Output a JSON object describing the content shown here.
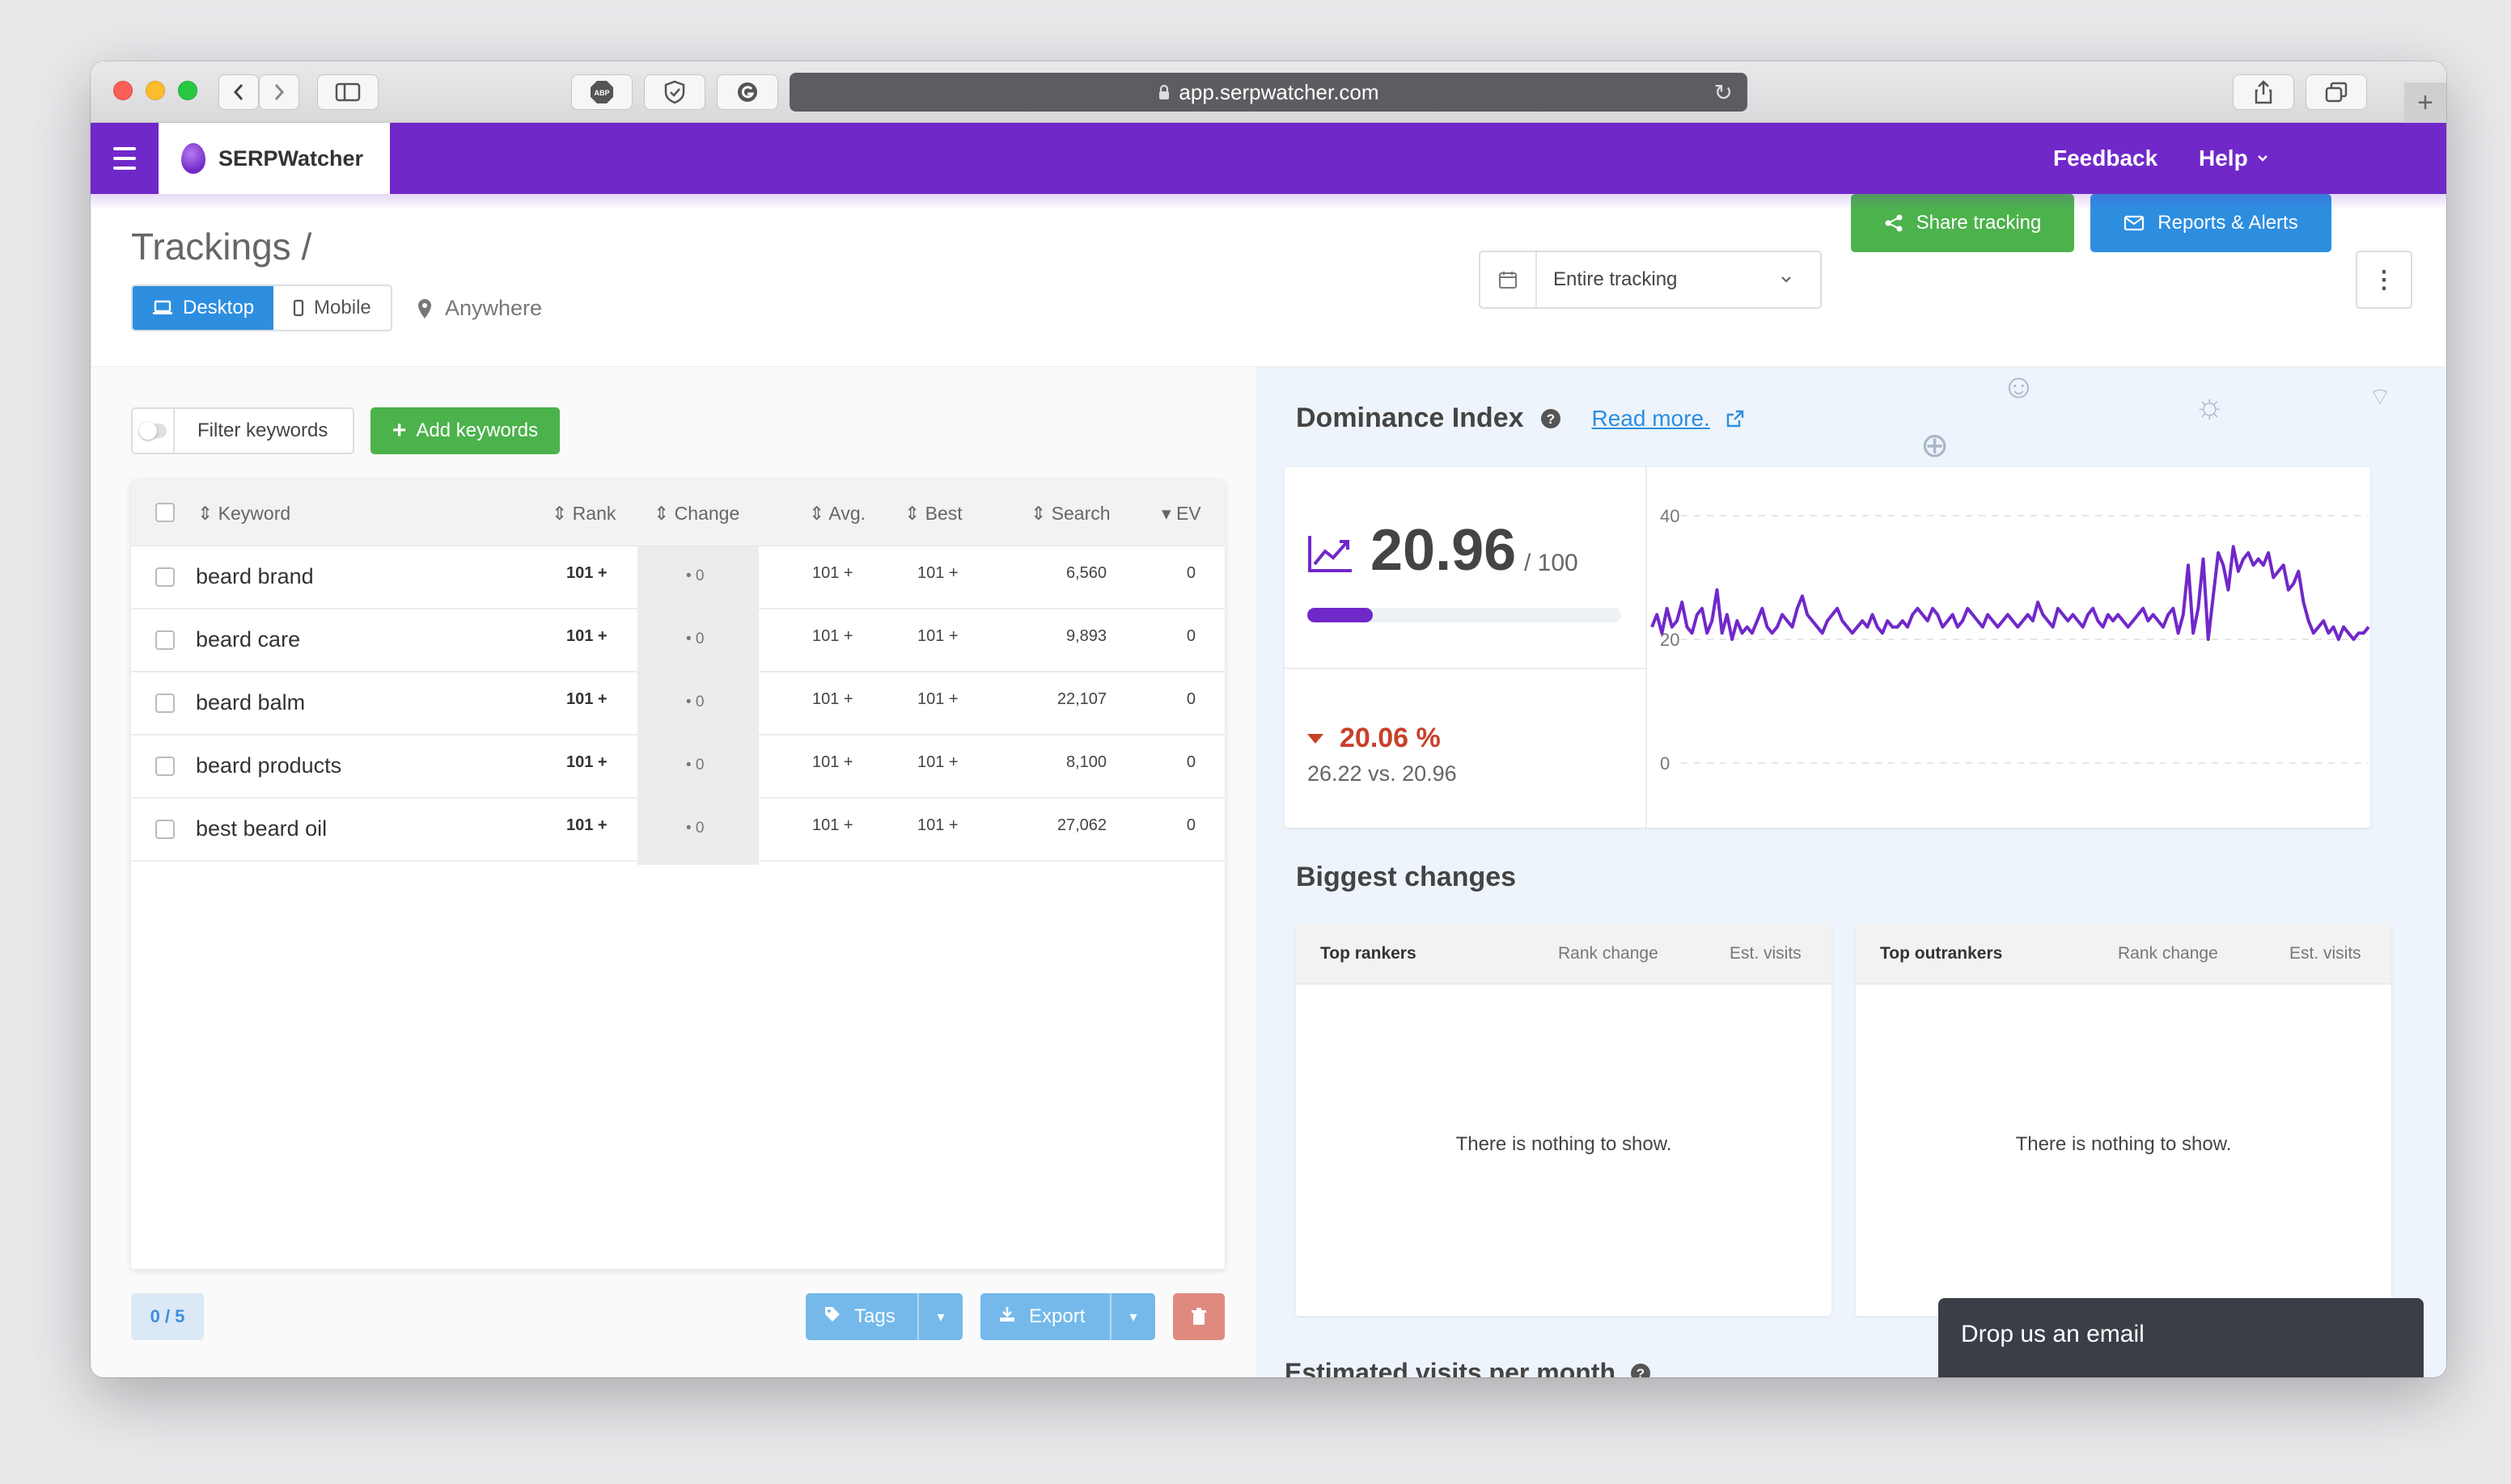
{
  "browser": {
    "url": "app.serpwatcher.com",
    "extensions": [
      "ABP",
      "shield-check",
      "G"
    ]
  },
  "app": {
    "brand": "SERPWatcher",
    "nav": {
      "feedback": "Feedback",
      "help": "Help"
    }
  },
  "page": {
    "title": "Trackings /",
    "device_tabs": [
      "Desktop",
      "Mobile"
    ],
    "location": "Anywhere",
    "date_range": "Entire tracking",
    "share_label": "Share tracking",
    "reports_label": "Reports & Alerts"
  },
  "keywords": {
    "filter_label": "Filter keywords",
    "add_label": "Add keywords",
    "columns": [
      "Keyword",
      "Rank",
      "Change",
      "Avg.",
      "Best",
      "Search",
      "EV"
    ],
    "rows": [
      {
        "keyword": "beard brand",
        "rank": "101 +",
        "change": "• 0",
        "avg": "101 +",
        "best": "101 +",
        "search": "6,560",
        "ev": "0"
      },
      {
        "keyword": "beard care",
        "rank": "101 +",
        "change": "• 0",
        "avg": "101 +",
        "best": "101 +",
        "search": "9,893",
        "ev": "0"
      },
      {
        "keyword": "beard balm",
        "rank": "101 +",
        "change": "• 0",
        "avg": "101 +",
        "best": "101 +",
        "search": "22,107",
        "ev": "0"
      },
      {
        "keyword": "beard products",
        "rank": "101 +",
        "change": "• 0",
        "avg": "101 +",
        "best": "101 +",
        "search": "8,100",
        "ev": "0"
      },
      {
        "keyword": "best beard oil",
        "rank": "101 +",
        "change": "• 0",
        "avg": "101 +",
        "best": "101 +",
        "search": "27,062",
        "ev": "0"
      }
    ],
    "selection_count": "0 / 5",
    "tags_label": "Tags",
    "export_label": "Export"
  },
  "dominance": {
    "title": "Dominance Index",
    "read_more": "Read more.",
    "value": "20.96",
    "out_of": "/ 100",
    "progress_fraction": 0.2096,
    "change_pct": "20.06 %",
    "comparison": "26.22 vs. 20.96",
    "colors": {
      "accent": "#7128c9",
      "down": "#c8402a"
    }
  },
  "chart_data": {
    "type": "line",
    "ylim": [
      0,
      40
    ],
    "yticks": [
      "40",
      "20",
      "0"
    ],
    "series": [
      {
        "values": [
          22,
          24,
          21,
          25,
          22,
          23,
          26,
          22,
          21,
          24,
          25,
          21,
          23,
          28,
          21,
          24,
          20,
          23,
          21,
          22,
          21,
          23,
          25,
          22,
          21,
          22,
          24,
          23,
          22,
          25,
          27,
          24,
          23,
          22,
          21,
          23,
          24,
          25,
          23,
          22,
          21,
          22,
          23,
          22,
          24,
          22,
          21,
          23,
          22,
          22,
          23,
          22,
          24,
          25,
          24,
          23,
          25,
          24,
          22,
          23,
          24,
          22,
          23,
          25,
          24,
          23,
          22,
          24,
          23,
          22,
          23,
          24,
          23,
          22,
          23,
          24,
          23,
          26,
          24,
          23,
          22,
          25,
          24,
          23,
          24,
          23,
          22,
          24,
          25,
          23,
          22,
          24,
          23,
          24,
          23,
          22,
          23,
          24,
          25,
          23,
          24,
          23,
          22,
          24,
          25,
          21,
          24,
          32,
          21,
          25,
          33,
          20,
          27,
          34,
          32,
          28,
          35,
          31,
          33,
          34,
          32,
          33,
          32,
          34,
          30,
          31,
          32,
          28,
          29,
          31,
          26,
          23,
          21,
          22,
          23,
          21,
          22,
          20,
          22,
          21,
          20,
          21,
          21,
          22
        ]
      }
    ]
  },
  "biggest_changes": {
    "title": "Biggest changes",
    "cards": [
      {
        "heading": "Top rankers",
        "col2": "Rank change",
        "col3": "Est. visits",
        "empty": "There is nothing to show."
      },
      {
        "heading": "Top outrankers",
        "col2": "Rank change",
        "col3": "Est. visits",
        "empty": "There is nothing to show."
      }
    ]
  },
  "estimated_visits": {
    "title": "Estimated visits per month"
  },
  "chat": {
    "label": "Drop us an email"
  }
}
